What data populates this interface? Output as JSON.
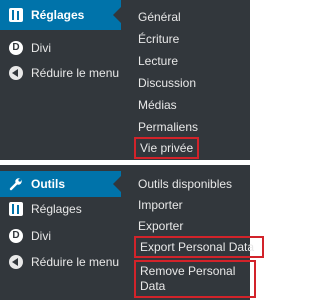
{
  "top_menu": {
    "items": [
      {
        "label": "Réglages",
        "icon": "settings-sliders-icon",
        "active": true
      },
      {
        "label": "Divi",
        "icon": "divi-icon"
      },
      {
        "label": "Réduire le menu",
        "icon": "collapse-arrow-icon"
      }
    ],
    "submenu": [
      "Général",
      "Écriture",
      "Lecture",
      "Discussion",
      "Médias",
      "Permaliens",
      "Vie privée"
    ],
    "highlighted": [
      "Vie privée"
    ]
  },
  "bottom_menu": {
    "items": [
      {
        "label": "Outils",
        "icon": "wrench-icon",
        "active": true
      },
      {
        "label": "Réglages",
        "icon": "settings-sliders-icon"
      },
      {
        "label": "Divi",
        "icon": "divi-icon"
      },
      {
        "label": "Réduire le menu",
        "icon": "collapse-arrow-icon"
      }
    ],
    "submenu": [
      "Outils disponibles",
      "Importer",
      "Exporter",
      "Export Personal Data",
      "Remove Personal Data"
    ],
    "highlighted": [
      "Export Personal Data",
      "Remove Personal Data"
    ]
  },
  "colors": {
    "sidebar_bg": "#32373c",
    "active_bg": "#0073aa",
    "highlight_border": "#d2232a",
    "text": "#e8e8e8"
  }
}
